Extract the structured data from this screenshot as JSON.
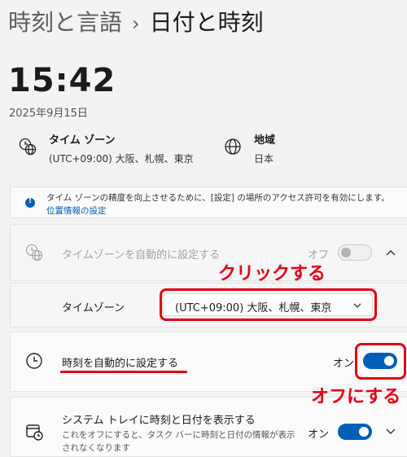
{
  "breadcrumb": {
    "parent": "時刻と言語",
    "separator": "›",
    "current": "日付と時刻"
  },
  "clock": {
    "time": "15:42",
    "date": "2025年9月15日"
  },
  "timezone_info": {
    "label": "タイム ゾーン",
    "value": "(UTC+09:00) 大阪、札幌、東京"
  },
  "region_info": {
    "label": "地域",
    "value": "日本"
  },
  "notice": {
    "text": "タイム ゾーンの精度を向上させるために、[設定] の場所のアクセス許可を有効にします。",
    "link": "位置情報の設定"
  },
  "auto_timezone": {
    "label": "タイムゾーンを自動的に設定する",
    "state": "オフ",
    "on": false,
    "enabled": false
  },
  "timezone": {
    "label": "タイムゾーン",
    "selected": "(UTC+09:00) 大阪、札幌、東京"
  },
  "auto_time": {
    "label": "時刻を自動的に設定する",
    "state": "オン",
    "on": true
  },
  "tray": {
    "label": "システム トレイに時刻と日付を表示する",
    "description": "これをオフにすると、タスク バーに時刻と日付の情報が表示されなくなります",
    "state": "オン",
    "on": true
  },
  "annotations": {
    "click": "クリックする",
    "turn_off": "オフにする"
  },
  "colors": {
    "accent": "#005fb8",
    "annotation": "#e60012",
    "background": "#f3f3f3"
  }
}
